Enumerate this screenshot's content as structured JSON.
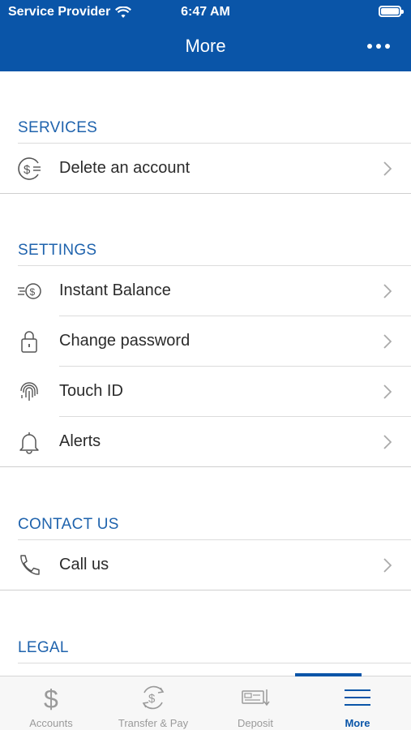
{
  "status_bar": {
    "carrier": "Service Provider",
    "time": "6:47 AM"
  },
  "header": {
    "title": "More"
  },
  "sections": {
    "services": {
      "title": "SERVICES",
      "items": [
        {
          "label": "Delete an account",
          "icon": "dollar-circle-icon"
        }
      ]
    },
    "settings": {
      "title": "SETTINGS",
      "items": [
        {
          "label": "Instant Balance",
          "icon": "speed-dollar-icon"
        },
        {
          "label": "Change password",
          "icon": "lock-icon"
        },
        {
          "label": "Touch ID",
          "icon": "fingerprint-icon"
        },
        {
          "label": "Alerts",
          "icon": "bell-icon"
        }
      ]
    },
    "contact": {
      "title": "CONTACT US",
      "items": [
        {
          "label": "Call us",
          "icon": "phone-icon"
        }
      ]
    },
    "legal": {
      "title": "LEGAL"
    }
  },
  "tabs": [
    {
      "label": "Accounts",
      "icon": "dollar-icon"
    },
    {
      "label": "Transfer & Pay",
      "icon": "transfer-icon"
    },
    {
      "label": "Deposit",
      "icon": "check-deposit-icon"
    },
    {
      "label": "More",
      "icon": "menu-icon",
      "active": true
    }
  ],
  "colors": {
    "brand": "#0a55a8",
    "section_title": "#1f63ad",
    "inactive_tab": "#9a9a9a"
  }
}
